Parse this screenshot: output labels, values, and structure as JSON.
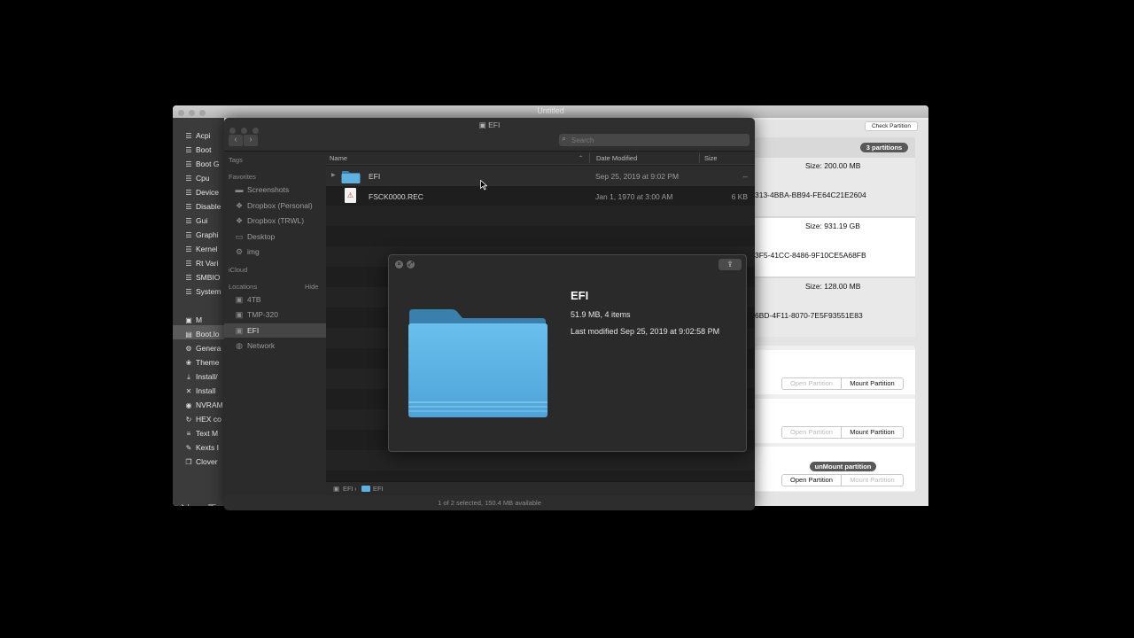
{
  "back_window": {
    "title": "Untitled",
    "sidebar": [
      {
        "icon": "list-icon",
        "label": "Acpi"
      },
      {
        "icon": "list-icon",
        "label": "Boot"
      },
      {
        "icon": "list-icon",
        "label": "Boot G"
      },
      {
        "icon": "list-icon",
        "label": "Cpu"
      },
      {
        "icon": "list-icon",
        "label": "Device"
      },
      {
        "icon": "list-icon",
        "label": "Disable"
      },
      {
        "icon": "list-icon",
        "label": "Gui"
      },
      {
        "icon": "list-icon",
        "label": "Graphi"
      },
      {
        "icon": "list-icon",
        "label": "Kernel"
      },
      {
        "icon": "list-icon",
        "label": "Rt Vari"
      },
      {
        "icon": "list-icon",
        "label": "SMBIO"
      },
      {
        "icon": "list-icon",
        "label": "System"
      },
      {
        "icon": "disk-icon",
        "label": "M"
      },
      {
        "icon": "doc-icon",
        "label": "Boot.lo"
      },
      {
        "icon": "gear-icon",
        "label": "Genera"
      },
      {
        "icon": "palette-icon",
        "label": "Theme"
      },
      {
        "icon": "download-icon",
        "label": "Install/"
      },
      {
        "icon": "tools-icon",
        "label": "Install"
      },
      {
        "icon": "chip-icon",
        "label": "NVRAM"
      },
      {
        "icon": "refresh-icon",
        "label": "HEX co"
      },
      {
        "icon": "text-icon",
        "label": "Text M"
      },
      {
        "icon": "wrench-icon",
        "label": "Kexts I"
      },
      {
        "icon": "copy-icon",
        "label": "Clover"
      }
    ],
    "check_partition_label": "Check Partition",
    "partitions_badge": "3 partitions",
    "partitions": [
      {
        "size": "Size:  200.00 MB",
        "guid": "313-4BBA-BB94-FE64C21E2604"
      },
      {
        "size": "Size:  931.19 GB",
        "guid": "3F5-41CC-8486-9F10CE5A68FB"
      },
      {
        "size": "Size:  128.00 MB",
        "guid": "6BD-4F11-8070-7E5F93551E83"
      }
    ],
    "mount_rows": [
      {
        "badge": "",
        "open": "Open Partition",
        "mount": "Mount Partition",
        "open_enabled": false,
        "mount_enabled": true
      },
      {
        "badge": "",
        "open": "Open Partition",
        "mount": "Mount Partition",
        "open_enabled": false,
        "mount_enabled": true
      },
      {
        "badge": "unMount partition",
        "open": "Open Partition",
        "mount": "Mount Partition",
        "open_enabled": true,
        "mount_enabled": false
      }
    ]
  },
  "finder": {
    "title": "EFI",
    "search_placeholder": "Search",
    "sidebar": {
      "tags_header": "Tags",
      "favorites_header": "Favorites",
      "favorites": [
        {
          "icon": "folder-icon",
          "label": "Screenshots"
        },
        {
          "icon": "dropbox-icon",
          "label": "Dropbox (Personal)"
        },
        {
          "icon": "dropbox-icon",
          "label": "Dropbox (TRWL)"
        },
        {
          "icon": "desktop-icon",
          "label": "Desktop"
        },
        {
          "icon": "gear-icon",
          "label": "img"
        }
      ],
      "icloud_header": "iCloud",
      "locations_header": "Locations",
      "hide_label": "Hide",
      "locations": [
        {
          "icon": "disk-icon",
          "label": "4TB"
        },
        {
          "icon": "disk-icon",
          "label": "TMP-320"
        },
        {
          "icon": "disk-icon",
          "label": "EFI"
        },
        {
          "icon": "globe-icon",
          "label": "Network"
        }
      ]
    },
    "columns": {
      "name": "Name",
      "date": "Date Modified",
      "size": "Size"
    },
    "files": [
      {
        "name": "EFI",
        "date": "Sep 25, 2019 at 9:02 PM",
        "size": "--",
        "kind": "folder"
      },
      {
        "name": "FSCK0000.REC",
        "date": "Jan 1, 1970 at 3:00 AM",
        "size": "6 KB",
        "kind": "document"
      }
    ],
    "path": [
      "EFI",
      "EFI"
    ],
    "path_sep": "›",
    "status": "1 of 2 selected, 150.4 MB available"
  },
  "quicklook": {
    "name": "EFI",
    "summary": "51.9 MB, 4 items",
    "modified": "Last modified Sep 25, 2019 at 9:02:58 PM"
  },
  "colors": {
    "folder_blue": "#5fb2e0",
    "finder_bg": "#1e1e1e",
    "badge_gray": "#595959"
  }
}
